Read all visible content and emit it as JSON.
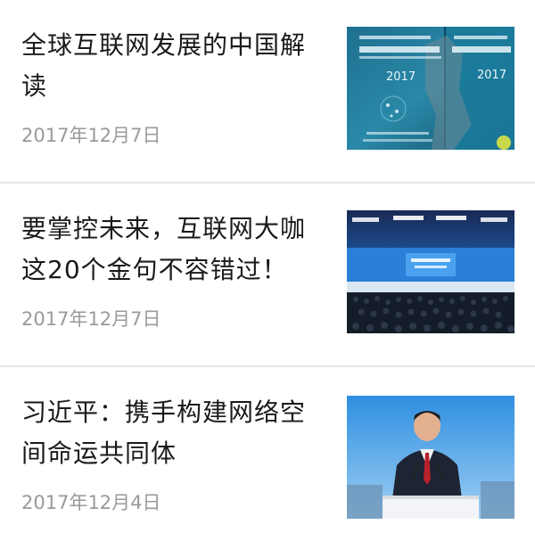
{
  "articles": [
    {
      "title": "全球互联网发展的中国解读",
      "date": "2017年12月7日",
      "thumbnail": {
        "subject": "report-cover",
        "cover_text_cn": "世界互联网发展报告",
        "cover_year": "2017",
        "cover_text_en": "World Internet Development Report"
      }
    },
    {
      "title": "要掌控未来，互联网大咖这20个金句不容错过！",
      "date": "2017年12月7日",
      "thumbnail": {
        "subject": "conference-hall"
      }
    },
    {
      "title": "习近平：携手构建网络空间命运共同体",
      "date": "2017年12月4日",
      "thumbnail": {
        "subject": "speaker-at-podium"
      }
    }
  ],
  "colors": {
    "title": "#1a1a1a",
    "date": "#9a9a9a",
    "divider": "#e4e4e4"
  }
}
